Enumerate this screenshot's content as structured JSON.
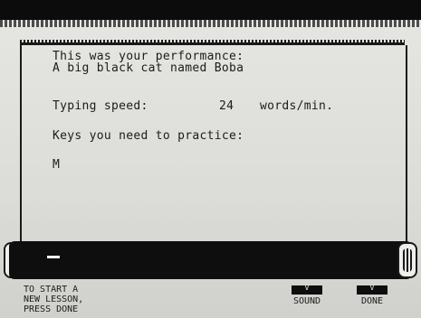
{
  "performance": {
    "heading": "This was your performance:",
    "lesson_text": "A big black cat named Boba",
    "speed_label": "Typing speed:",
    "speed_value": "24",
    "speed_unit": "words/min.",
    "keys_label": "Keys you need to practice:",
    "keys_value": "M"
  },
  "input": {
    "cursor_glyph": "_"
  },
  "footer": {
    "hint": "TO START A\nNEW LESSON,\nPRESS DONE",
    "sound_key": "V",
    "sound_label": "SOUND",
    "done_key": "V",
    "done_label": "DONE"
  },
  "colors": {
    "screen": "#dcdcd8",
    "ink": "#1c1c1c",
    "bar": "#0e0e0e"
  }
}
